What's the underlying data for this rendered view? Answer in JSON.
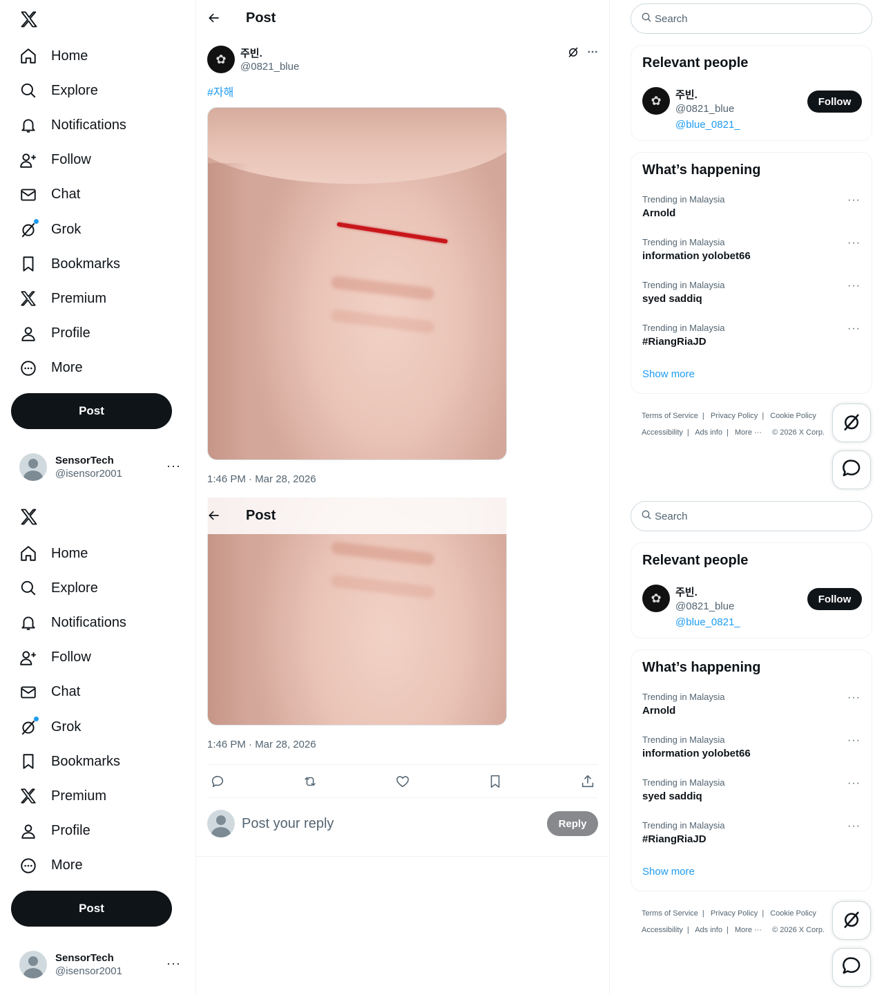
{
  "nav": {
    "items": [
      {
        "label": "Home",
        "icon": "home-icon"
      },
      {
        "label": "Explore",
        "icon": "search-icon"
      },
      {
        "label": "Notifications",
        "icon": "bell-icon"
      },
      {
        "label": "Follow",
        "icon": "add-person-icon"
      },
      {
        "label": "Chat",
        "icon": "envelope-icon"
      },
      {
        "label": "Grok",
        "icon": "grok-icon"
      },
      {
        "label": "Bookmarks",
        "icon": "bookmark-icon"
      },
      {
        "label": "Premium",
        "icon": "x-logo-icon"
      },
      {
        "label": "Profile",
        "icon": "person-icon"
      },
      {
        "label": "More",
        "icon": "more-circle-icon"
      }
    ],
    "post_label": "Post",
    "account": {
      "display_name": "SensorTech",
      "handle": "@isensor2001"
    }
  },
  "header": {
    "title": "Post"
  },
  "post": {
    "author": {
      "display_name": "주빈.",
      "handle": "@0821_blue"
    },
    "hashtag": "#자해",
    "timestamp": "1:46 PM · Mar 28, 2026"
  },
  "reply": {
    "placeholder": "Post your reply",
    "button": "Reply"
  },
  "sidebar": {
    "search_placeholder": "Search",
    "relevant": {
      "title": "Relevant people",
      "person": {
        "display_name": "주빈.",
        "handle": "@0821_blue",
        "bio_link": "@blue_0821_",
        "follow_label": "Follow"
      }
    },
    "happening": {
      "title": "What’s happening",
      "trends": [
        {
          "context": "Trending in Malaysia",
          "name": "Arnold"
        },
        {
          "context": "Trending in Malaysia",
          "name": "information yolobet66"
        },
        {
          "context": "Trending in Malaysia",
          "name": "syed saddiq"
        },
        {
          "context": "Trending in Malaysia",
          "name": "#RiangRiaJD"
        }
      ],
      "show_more": "Show more"
    },
    "footer": {
      "links_row1": [
        "Terms of Service",
        "Privacy Policy",
        "Cookie Policy"
      ],
      "links_row2": [
        "Accessibility",
        "Ads info",
        "More ···"
      ],
      "copyright": "© 2026 X Corp."
    }
  },
  "colors": {
    "accent": "#1d9bf0",
    "text": "#0f1419",
    "muted": "#536471",
    "border": "#eff3f4"
  }
}
